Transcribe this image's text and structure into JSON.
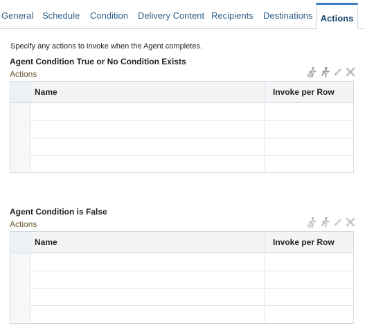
{
  "tabs": [
    {
      "label": "General"
    },
    {
      "label": "Schedule"
    },
    {
      "label": "Condition"
    },
    {
      "label": "Delivery Content"
    },
    {
      "label": "Recipients"
    },
    {
      "label": "Destinations"
    },
    {
      "label": "Actions"
    }
  ],
  "active_tab": "Actions",
  "intro_text": "Specify any actions to invoke when the Agent completes.",
  "sections": [
    {
      "title": "Agent Condition True or No Condition Exists",
      "subtitle": "Actions",
      "columns": [
        "Name",
        "Invoke per Row"
      ],
      "toolbar_icons": [
        "add-action-icon",
        "run-action-icon",
        "edit-pencil-icon",
        "delete-x-icon"
      ],
      "row_count": 4
    },
    {
      "title": "Agent Condition is False",
      "subtitle": "Actions",
      "columns": [
        "Name",
        "Invoke per Row"
      ],
      "toolbar_icons": [
        "add-action-icon",
        "run-action-icon",
        "edit-pencil-icon",
        "delete-x-icon"
      ],
      "row_count": 4
    }
  ],
  "colors": {
    "accent": "#3b7ec2",
    "tab_text": "#2d5f8a",
    "subtitle_text": "#6b5b2e"
  }
}
